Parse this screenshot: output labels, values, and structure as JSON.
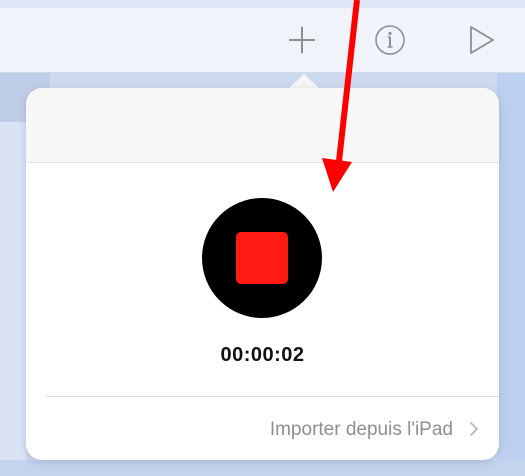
{
  "toolbar": {
    "icons": [
      "plus-icon",
      "info-icon",
      "play-icon"
    ]
  },
  "recorder": {
    "elapsed_time": "00:00:02",
    "state": "recording"
  },
  "import_row": {
    "label": "Importer depuis l'iPad"
  },
  "colors": {
    "stop_button": "#ff1a12",
    "record_circle": "#000000",
    "annotation_arrow": "#ff0000",
    "secondary_text": "#8e8e93"
  }
}
